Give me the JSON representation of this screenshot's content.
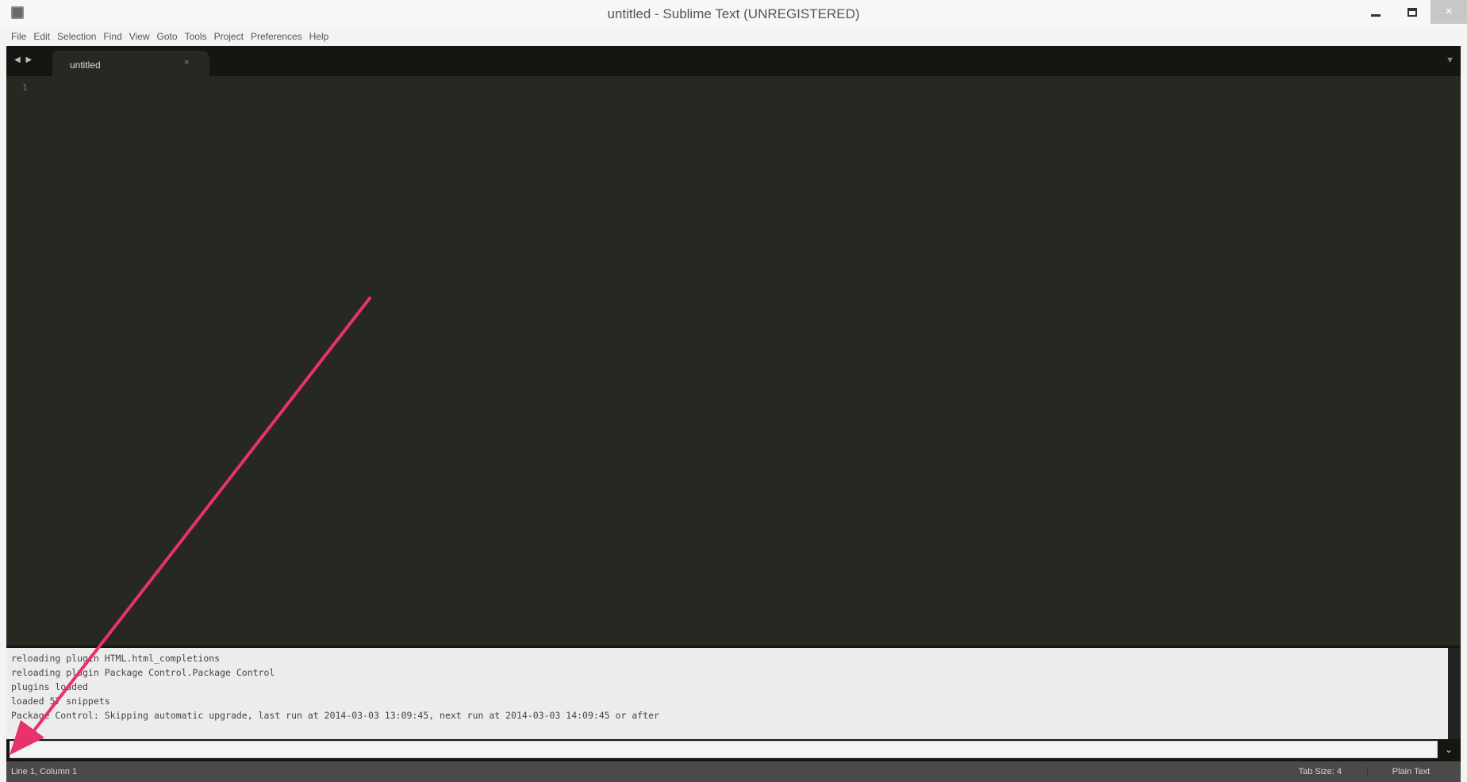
{
  "window": {
    "title": "untitled - Sublime Text (UNREGISTERED)",
    "minimize_glyph": "_",
    "close_glyph": "×"
  },
  "menu": {
    "items": [
      "File",
      "Edit",
      "Selection",
      "Find",
      "View",
      "Goto",
      "Tools",
      "Project",
      "Preferences",
      "Help"
    ]
  },
  "tabs": {
    "nav_glyph": "◀ ▶",
    "items": [
      {
        "label": "untitled",
        "close": "×"
      }
    ],
    "menu_glyph": "▼"
  },
  "editor": {
    "line_numbers": [
      "1"
    ]
  },
  "console": {
    "lines": [
      "reloading plugin HTML.html_completions",
      "reloading plugin Package Control.Package Control",
      "plugins loaded",
      "loaded 57 snippets",
      "Package Control: Skipping automatic upgrade, last run at 2014-03-03 13:09:45, next run at 2014-03-03 14:09:45 or after"
    ],
    "input_value": "",
    "history_glyph": "⌄"
  },
  "status": {
    "position": "Line 1, Column 1",
    "tab_size": "Tab Size: 4",
    "syntax": "Plain Text"
  },
  "colors": {
    "editor_bg": "#272822",
    "chrome_dark": "#151512",
    "annotation_arrow": "#e8326a"
  },
  "icons": {
    "app": "sublime-text-icon",
    "arrow": "annotation-arrow-icon"
  }
}
